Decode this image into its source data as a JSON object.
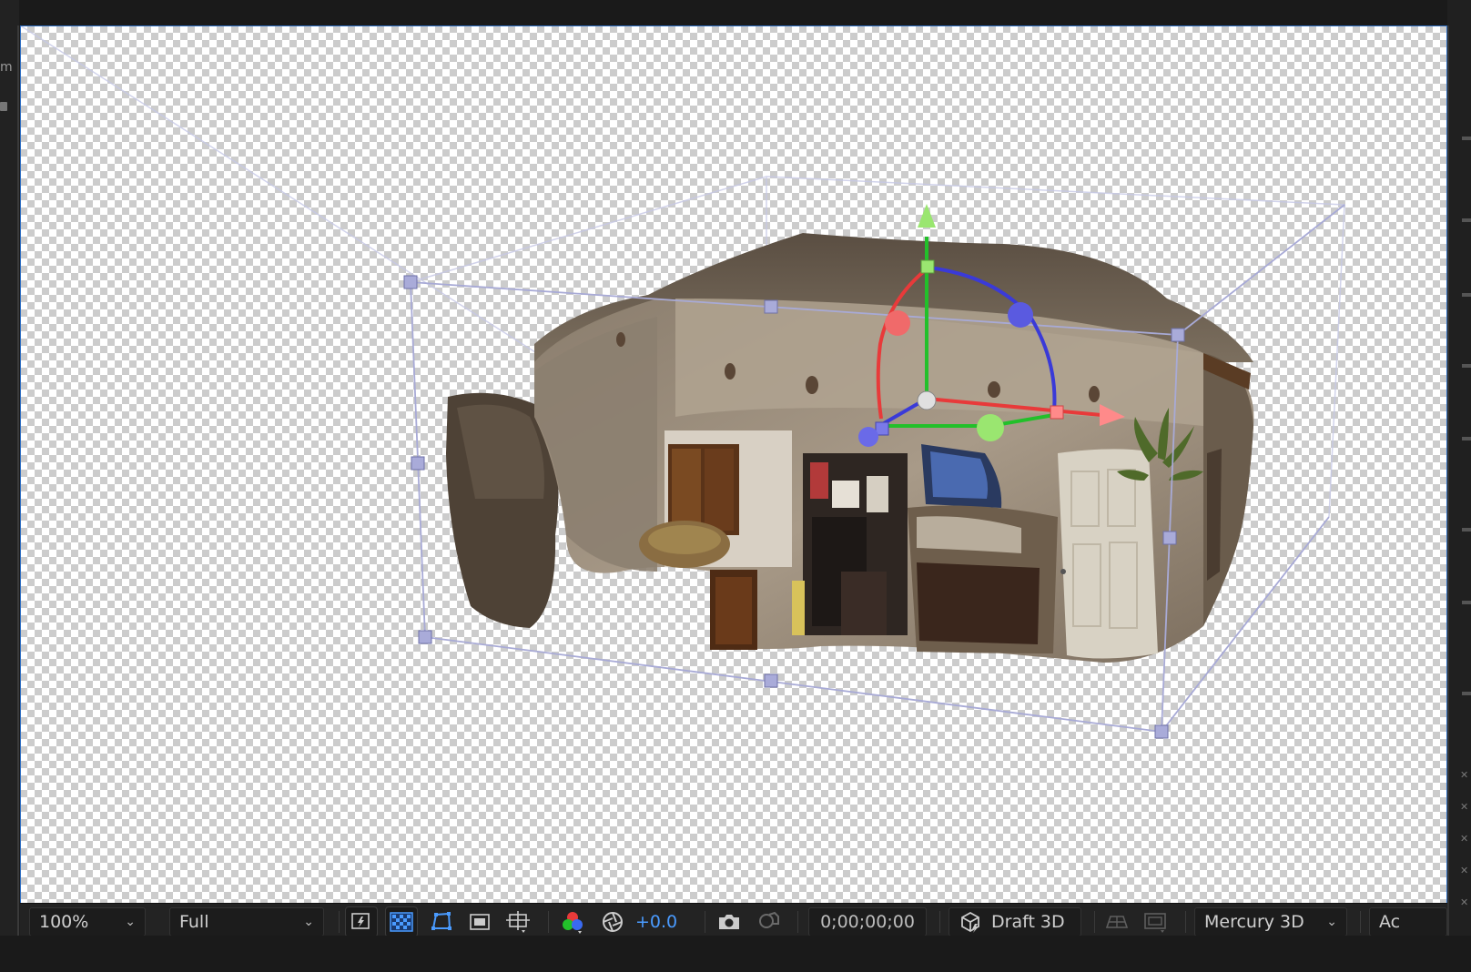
{
  "viewer": {
    "zoom_label": "100%",
    "resolution_label": "Full",
    "exposure_value": "+0.0",
    "timecode": "0;00;00;00",
    "draft_3d_label": "Draft 3D",
    "renderer_label": "Mercury 3D",
    "truncated_label": "Ac"
  },
  "icons": {
    "fast_preview": "fast-preview-icon",
    "transparency_grid": "transparency-grid-icon",
    "mask_path": "mask-path-icon",
    "region_of_interest": "region-of-interest-icon",
    "safe_margins": "safe-margins-icon",
    "channels": "rgb-channels-icon",
    "exposure_reset": "aperture-icon",
    "snapshot": "camera-icon",
    "show_snapshot": "show-snapshot-icon",
    "draft_3d": "draft-3d-cube-icon",
    "ground_plane": "ground-plane-icon",
    "extended_viewer": "extended-viewer-icon"
  },
  "colors": {
    "accent_blue": "#4a9bff",
    "gizmo_x": "#e83a3a",
    "gizmo_y": "#22c02a",
    "gizmo_z": "#3a3ad8",
    "bounding_box": "#a8aad6",
    "viewer_border": "#2f6ec2"
  }
}
